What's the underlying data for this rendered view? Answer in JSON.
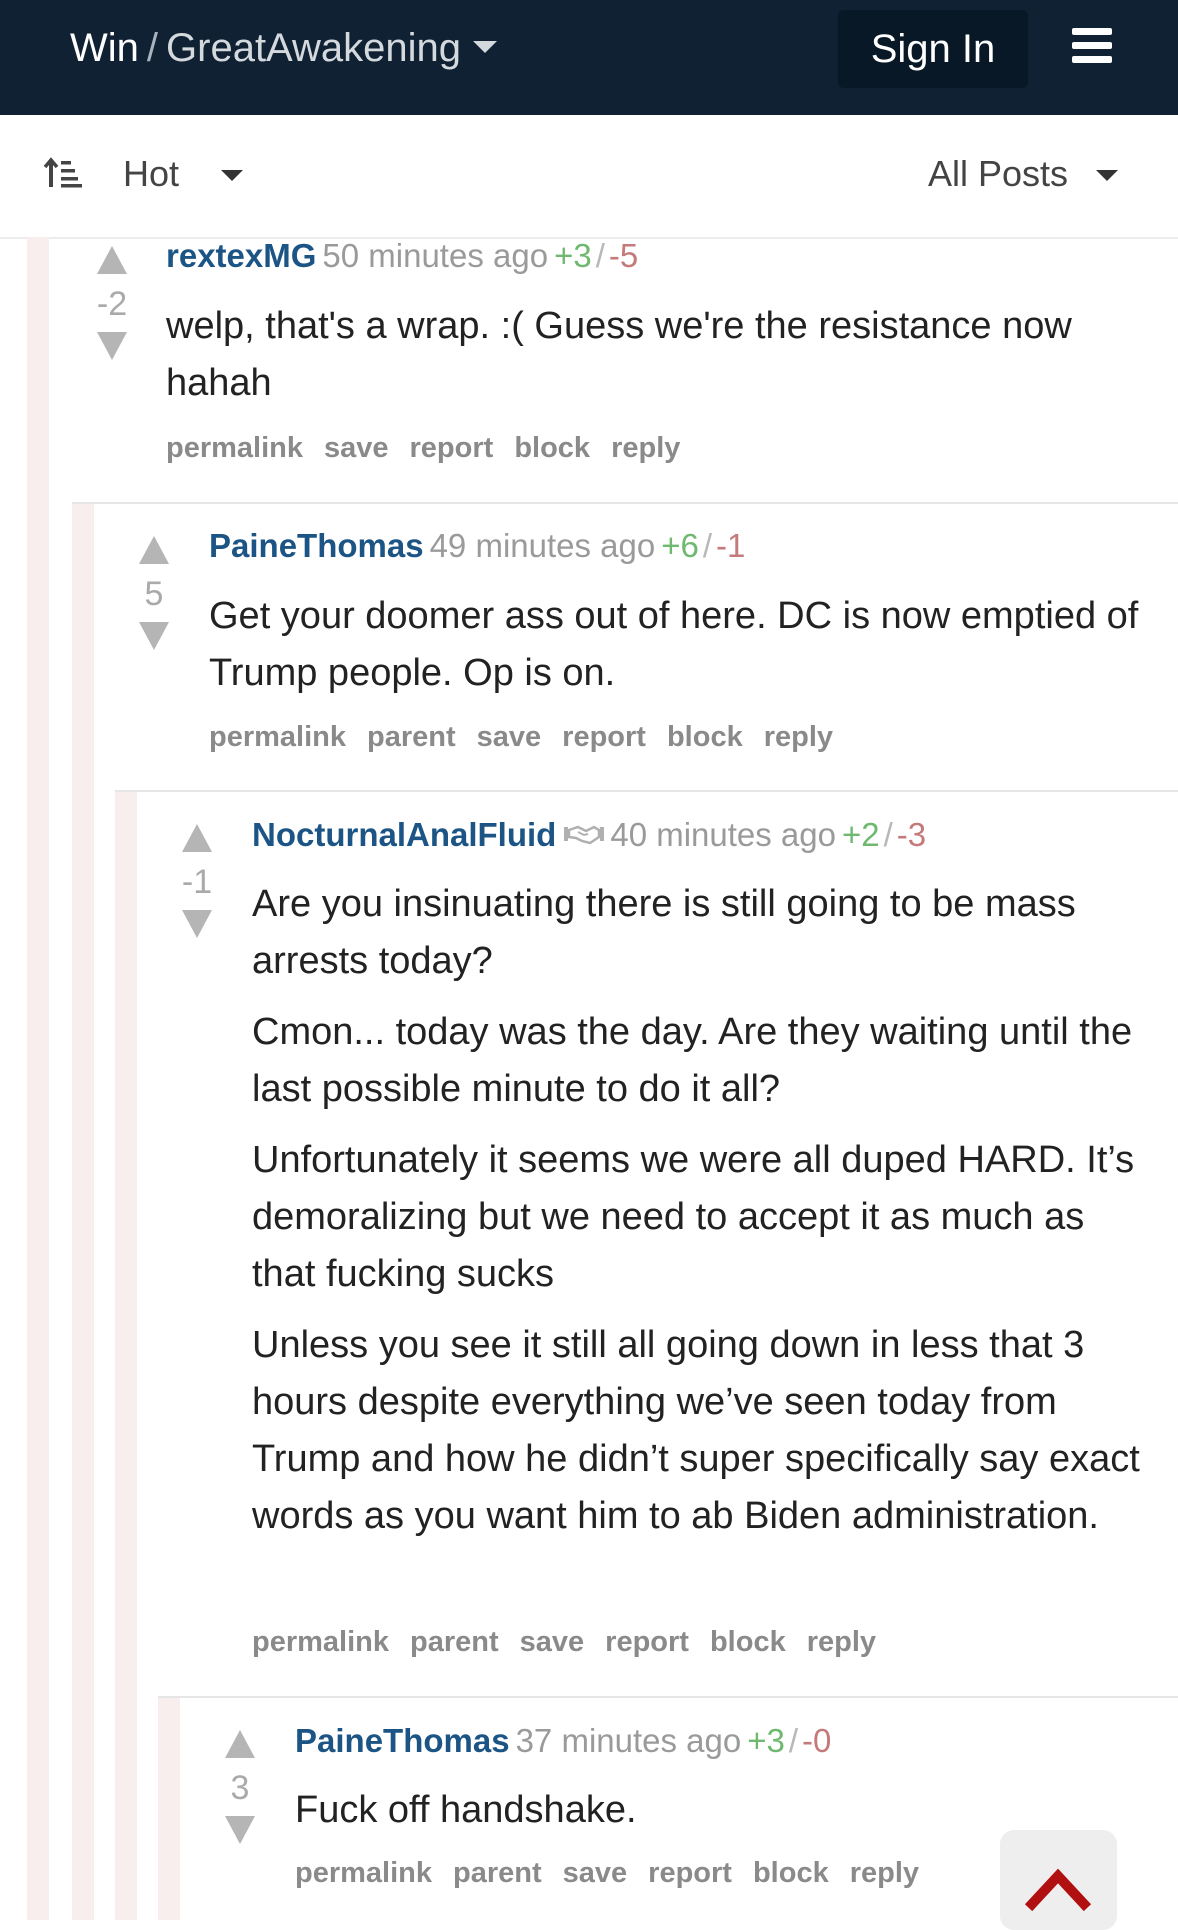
{
  "header": {
    "site": "Win",
    "separator": "/",
    "community": "GreatAwakening",
    "sign_in_label": "Sign In",
    "menu_icon": "hamburger-menu-icon"
  },
  "sortbar": {
    "sort_icon": "sort-order-icon",
    "sort_value": "Hot",
    "filter_value": "All Posts"
  },
  "colors": {
    "header_bg": "#0f2132",
    "author": "#1c5585",
    "upvotes": "#6fb86f",
    "downvotes": "#c47a7a",
    "scroll_arrow": "#b01010"
  },
  "comments": [
    {
      "author": "rextexMG",
      "time": "50 minutes ago",
      "up": "+3",
      "down": "-5",
      "score": "-2",
      "body": [
        "welp, that's a wrap. :( Guess we're the resistance now hahah"
      ],
      "actions": [
        "permalink",
        "save",
        "report",
        "block",
        "reply"
      ]
    },
    {
      "author": "PaineThomas",
      "time": "49 minutes ago",
      "up": "+6",
      "down": "-1",
      "score": "5",
      "body": [
        "Get your doomer ass out of here. DC is now emptied of Trump people. Op is on."
      ],
      "actions": [
        "permalink",
        "parent",
        "save",
        "report",
        "block",
        "reply"
      ]
    },
    {
      "author": "NocturnalAnalFluid",
      "flair_icon": "handshake-icon",
      "time": "40 minutes ago",
      "up": "+2",
      "down": "-3",
      "score": "-1",
      "body": [
        "Are you insinuating there is still going to be mass arrests today?",
        "Cmon... today was the day. Are they waiting until the last possible minute to do it all?",
        "Unfortunately it seems we were all duped HARD. It’s demoralizing but we need to accept it as much as that fucking sucks",
        "Unless you see it still all going down in less that 3 hours despite everything we’ve seen today from Trump and how he didn’t super specifically say exact words as you want him to ab Biden administration."
      ],
      "actions": [
        "permalink",
        "parent",
        "save",
        "report",
        "block",
        "reply"
      ]
    },
    {
      "author": "PaineThomas",
      "time": "37 minutes ago",
      "up": "+3",
      "down": "-0",
      "score": "3",
      "body": [
        "Fuck off handshake."
      ],
      "actions": [
        "permalink",
        "parent",
        "save",
        "report",
        "block",
        "reply"
      ]
    }
  ],
  "scroll_top_icon": "chevron-up-icon"
}
